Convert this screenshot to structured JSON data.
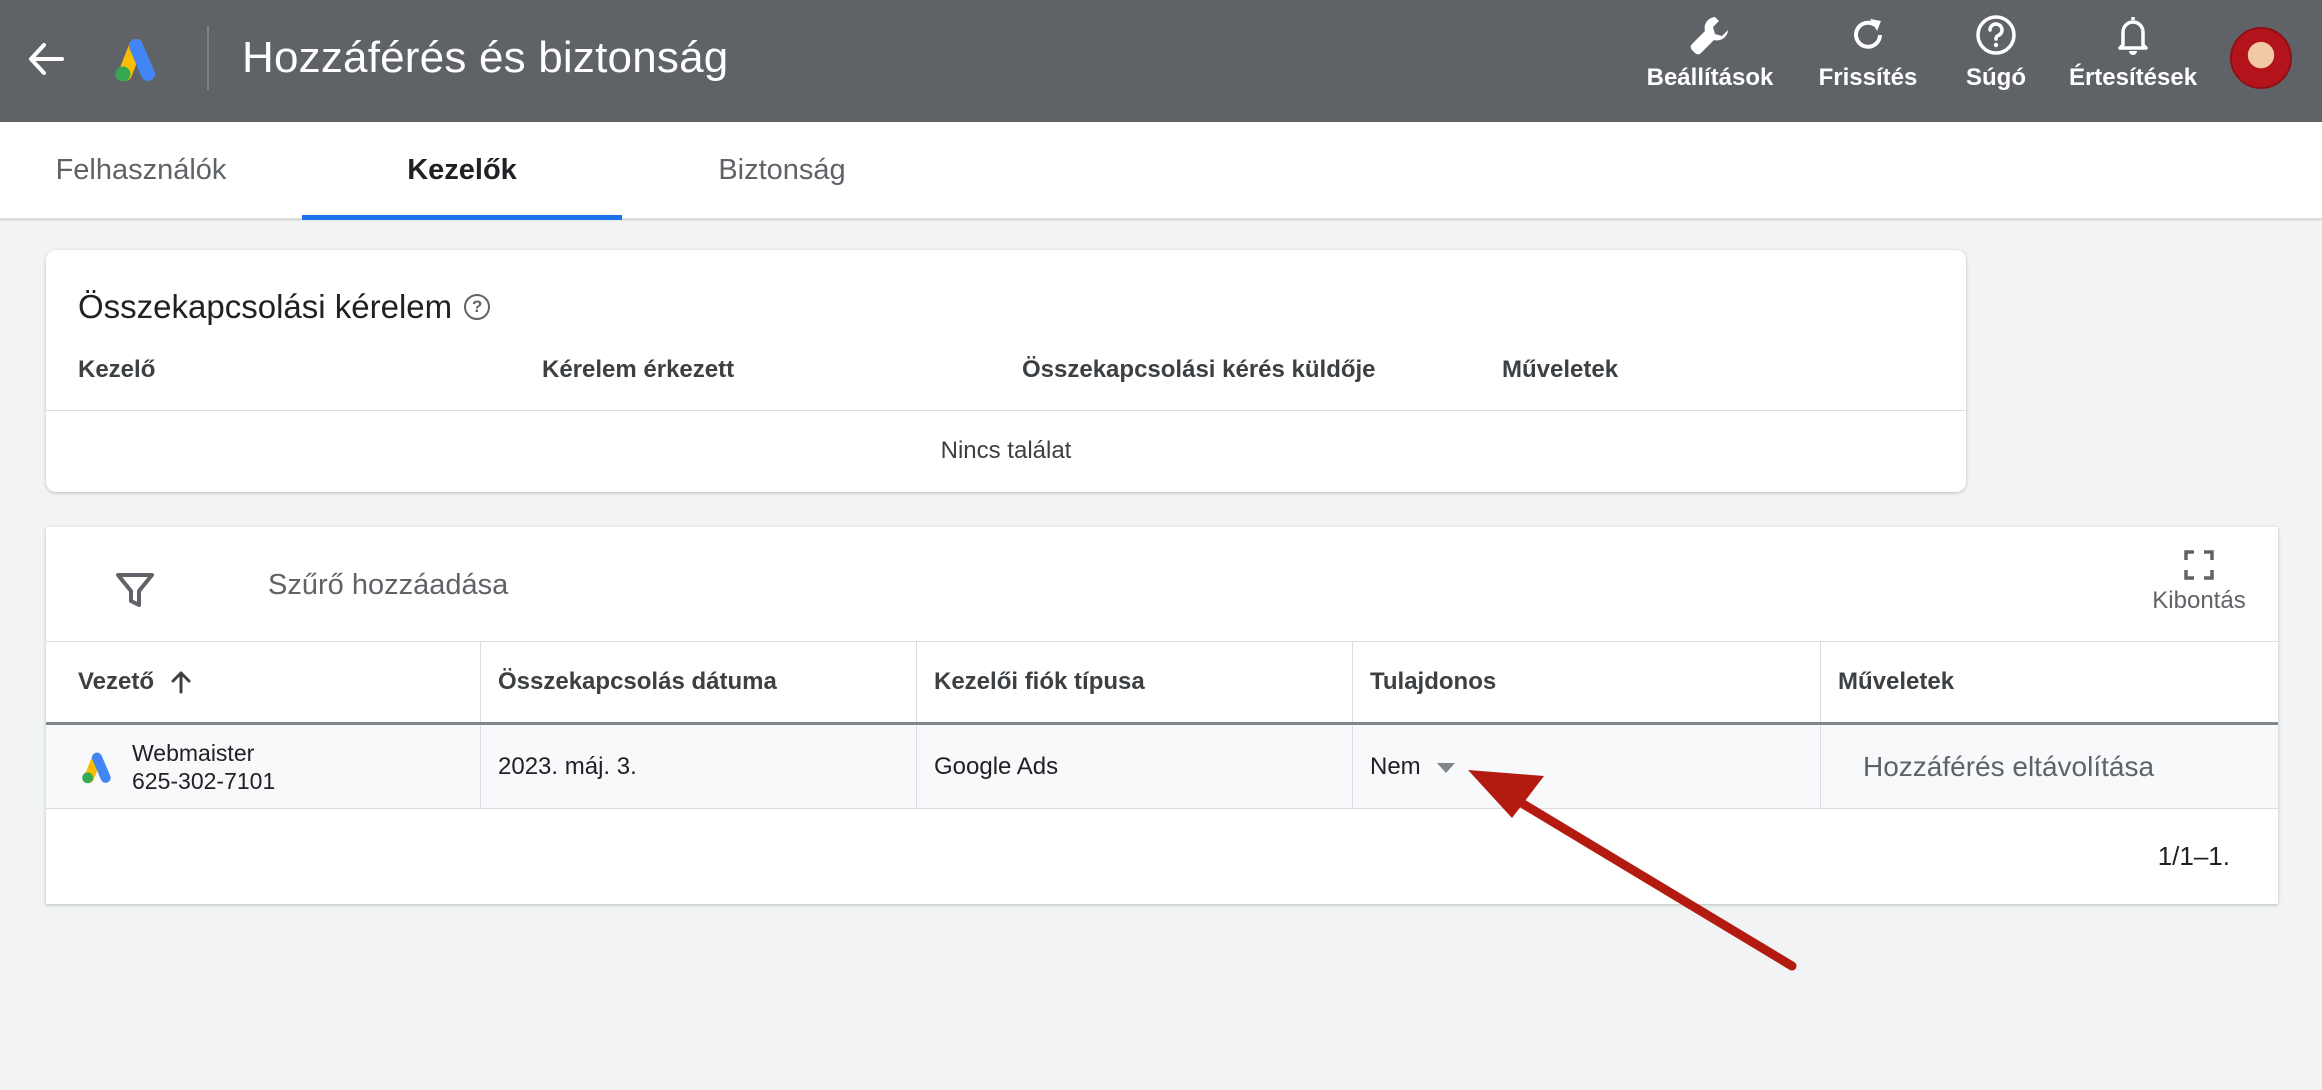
{
  "header": {
    "title": "Hozzáférés és biztonság",
    "tools": [
      {
        "label": "Beállítások",
        "icon": "wrench-icon"
      },
      {
        "label": "Frissítés",
        "icon": "refresh-icon"
      },
      {
        "label": "Súgó",
        "icon": "help-icon"
      },
      {
        "label": "Értesítések",
        "icon": "bell-icon"
      }
    ]
  },
  "tabs": [
    {
      "label": "Felhasználók"
    },
    {
      "label": "Kezelők",
      "active": true
    },
    {
      "label": "Biztonság"
    }
  ],
  "link_requests": {
    "title": "Összekapcsolási kérelem",
    "columns": [
      "Kezelő",
      "Kérelem érkezett",
      "Összekapcsolási kérés küldője",
      "Műveletek"
    ],
    "empty_text": "Nincs találat"
  },
  "managers": {
    "filter_label": "Szűrő hozzáadása",
    "expand_label": "Kibontás",
    "columns": [
      "Vezető",
      "Összekapcsolás dátuma",
      "Kezelői fiók típusa",
      "Tulajdonos",
      "Műveletek"
    ],
    "rows": [
      {
        "name": "Webmaister",
        "id": "625-302-7101",
        "date": "2023. máj. 3.",
        "type": "Google Ads",
        "owner": "Nem",
        "action": "Hozzáférés eltávolítása"
      }
    ],
    "pagination": "1/1–1."
  },
  "colors": {
    "header_bg": "#5f6368",
    "accent": "#1a73e8",
    "annotation_arrow": "#b31b10"
  }
}
